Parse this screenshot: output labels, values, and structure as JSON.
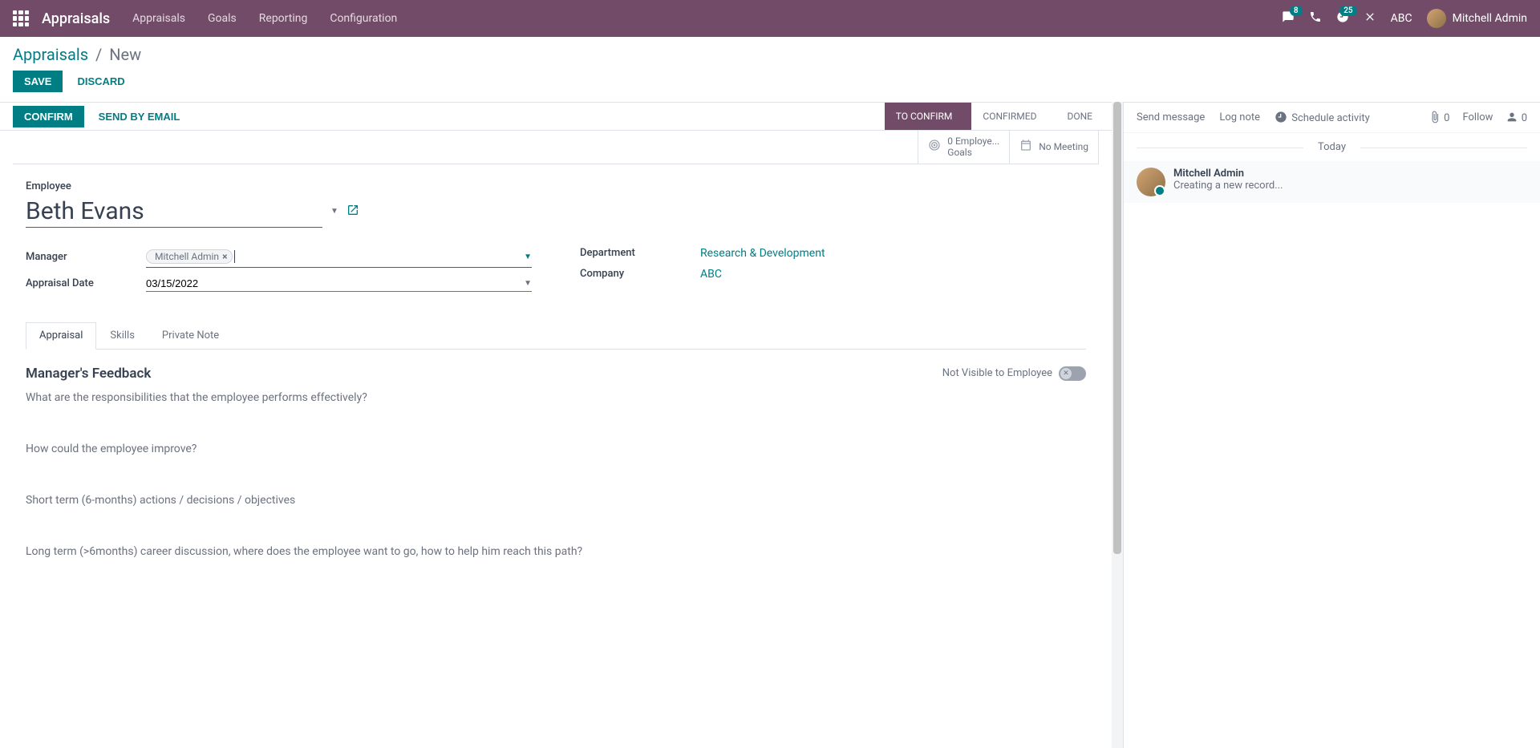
{
  "topbar": {
    "app_title": "Appraisals",
    "menu": [
      "Appraisals",
      "Goals",
      "Reporting",
      "Configuration"
    ],
    "chat_badge": "8",
    "clock_badge": "25",
    "company": "ABC",
    "user": "Mitchell Admin"
  },
  "breadcrumb": {
    "root": "Appraisals",
    "current": "New"
  },
  "actions": {
    "save": "SAVE",
    "discard": "DISCARD",
    "confirm": "CONFIRM",
    "send_email": "SEND BY EMAIL"
  },
  "status": {
    "steps": [
      "TO CONFIRM",
      "CONFIRMED",
      "DONE"
    ],
    "active_index": 0
  },
  "stat_buttons": {
    "goals_line1": "0 Employe...",
    "goals_line2": "Goals",
    "meeting": "No Meeting"
  },
  "form": {
    "employee_label": "Employee",
    "employee_name": "Beth Evans",
    "manager_label": "Manager",
    "manager_tag": "Mitchell Admin",
    "date_label": "Appraisal Date",
    "date_value": "03/15/2022",
    "department_label": "Department",
    "department_value": "Research & Development",
    "company_label": "Company",
    "company_value": "ABC"
  },
  "tabs": [
    "Appraisal",
    "Skills",
    "Private Note"
  ],
  "feedback": {
    "title": "Manager's Feedback",
    "toggle_label": "Not Visible to Employee",
    "q1": "What are the responsibilities that the employee performs effectively?",
    "q2": "How could the employee improve?",
    "q3": "Short term (6-months) actions / decisions / objectives",
    "q4": "Long term (>6months) career discussion, where does the employee want to go, how to help him reach this path?"
  },
  "chatter": {
    "send": "Send message",
    "log": "Log note",
    "schedule": "Schedule activity",
    "attach_count": "0",
    "follow": "Follow",
    "follower_count": "0",
    "today": "Today",
    "msg_author": "Mitchell Admin",
    "msg_text": "Creating a new record..."
  }
}
